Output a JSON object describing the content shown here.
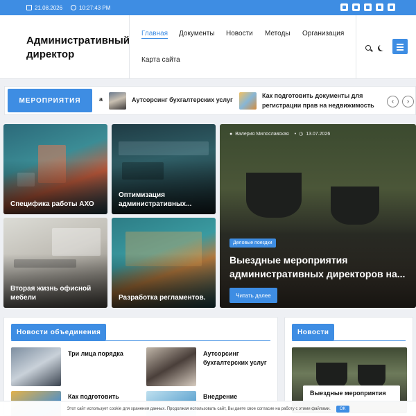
{
  "topbar": {
    "date": "21.08.2026",
    "time": "10:27:43 PM",
    "socials": [
      "vk-icon",
      "odnoklassniki-icon",
      "mail-icon",
      "youtube-icon",
      "phone-icon"
    ]
  },
  "header": {
    "site_title": "Административный директор",
    "nav": [
      "Главная",
      "Документы",
      "Новости",
      "Методы",
      "Организация",
      "Карта сайта"
    ]
  },
  "ticker": {
    "badge": "МЕРОПРИЯТИЯ",
    "prefix": "а",
    "items": [
      "Аутсорсинг бухгалтерских услуг",
      "Как подготовить документы для регистрации прав на недвижимость"
    ]
  },
  "grid": {
    "tiles": [
      "Специфика работы АХО",
      "Оптимизация административных...",
      "Вторая жизнь офисной мебели",
      "Разработка регламентов."
    ],
    "hero": {
      "author": "Валерия Милославская",
      "date": "13.07.2026",
      "category": "Деловые поездки",
      "title": "Выездные мероприятия административных директоров на...",
      "button": "Читать далее"
    }
  },
  "panels": {
    "left": {
      "title": "Новости объединения",
      "items": [
        "Три лица порядка",
        "Аутсорсинг бухгалтерских услуг",
        "Как подготовить",
        "Внедрение"
      ]
    },
    "right": {
      "title": "Новости",
      "item": "Выездные мероприятия"
    }
  },
  "cookie": {
    "text": "Этот сайт использует cookie для хранения данных. Продолжая использовать сайт, Вы даете свое согласие на работу с этими файлами.",
    "ok": "OK"
  },
  "colors": {
    "accent": "#3e8de3"
  }
}
